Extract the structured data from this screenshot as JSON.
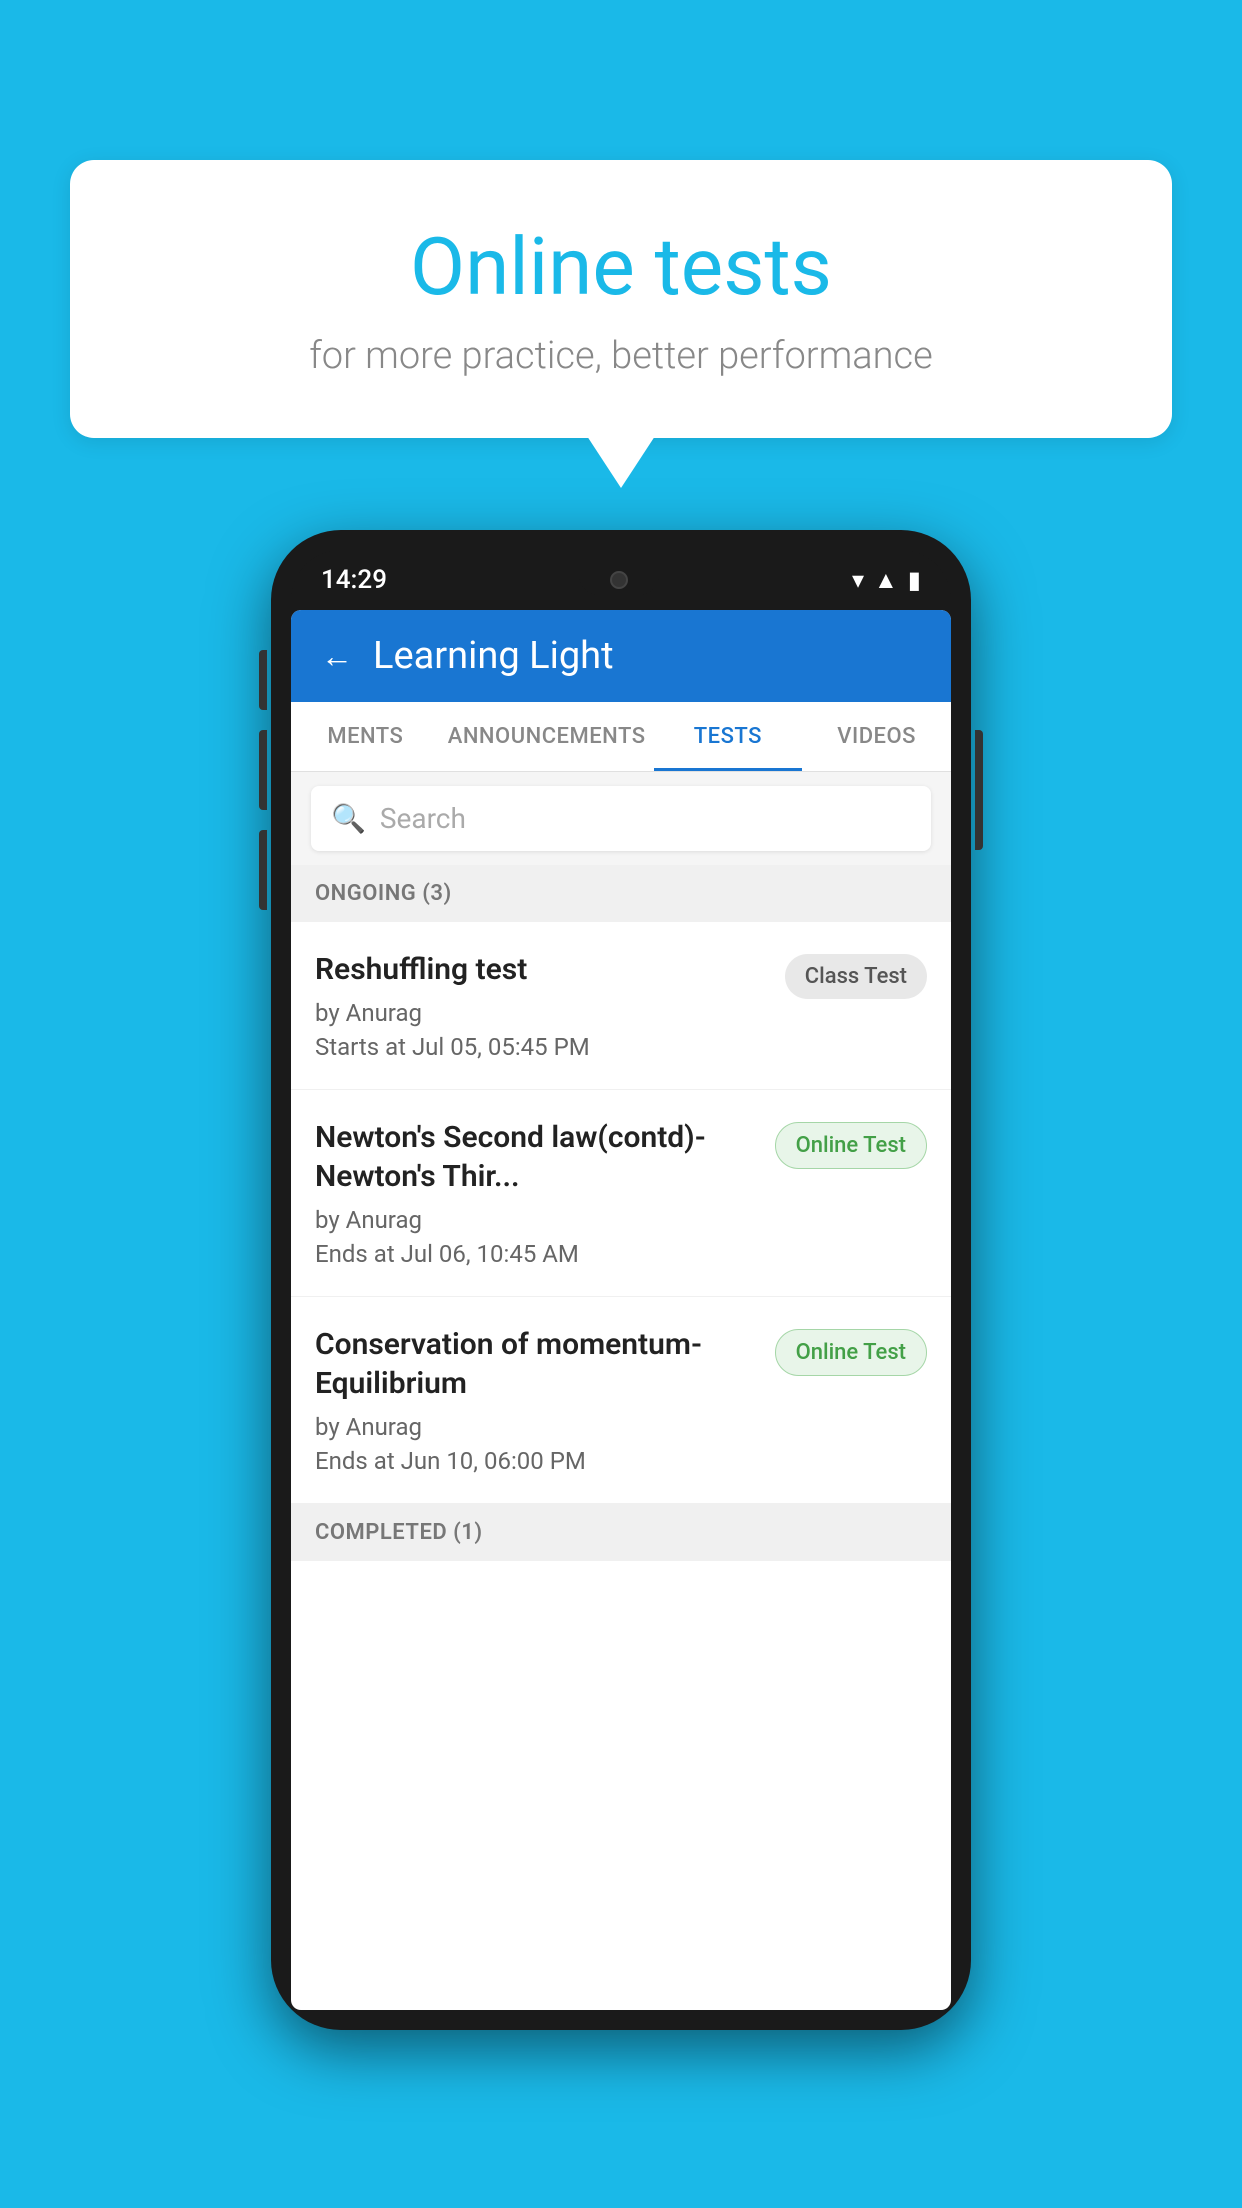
{
  "background": {
    "color": "#1ab9e8"
  },
  "speech_bubble": {
    "title": "Online tests",
    "subtitle": "for more practice, better performance"
  },
  "phone": {
    "time": "14:29",
    "app_header": {
      "back_label": "←",
      "title": "Learning Light"
    },
    "tabs": [
      {
        "label": "MENTS",
        "active": false
      },
      {
        "label": "ANNOUNCEMENTS",
        "active": false
      },
      {
        "label": "TESTS",
        "active": true
      },
      {
        "label": "VIDEOS",
        "active": false
      }
    ],
    "search": {
      "placeholder": "Search"
    },
    "ongoing_section": {
      "label": "ONGOING (3)"
    },
    "tests": [
      {
        "name": "Reshuffling test",
        "author": "by Anurag",
        "time_label": "Starts at",
        "time_value": "Jul 05, 05:45 PM",
        "badge": "Class Test",
        "badge_type": "class"
      },
      {
        "name": "Newton's Second law(contd)-Newton's Thir...",
        "author": "by Anurag",
        "time_label": "Ends at",
        "time_value": "Jul 06, 10:45 AM",
        "badge": "Online Test",
        "badge_type": "online"
      },
      {
        "name": "Conservation of momentum-Equilibrium",
        "author": "by Anurag",
        "time_label": "Ends at",
        "time_value": "Jun 10, 06:00 PM",
        "badge": "Online Test",
        "badge_type": "online"
      }
    ],
    "completed_section": {
      "label": "COMPLETED (1)"
    }
  }
}
